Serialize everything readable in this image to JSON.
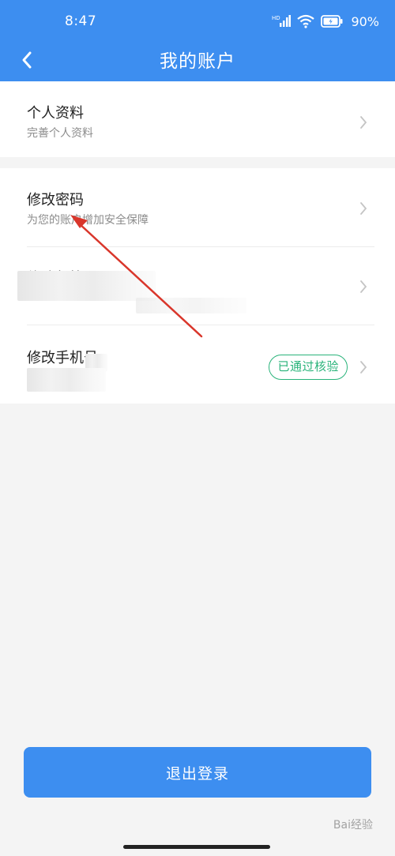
{
  "status_bar": {
    "time": "8:47",
    "network_label": "HD",
    "battery": "90%"
  },
  "header": {
    "title": "我的账户",
    "back_icon": "chevron-left-icon"
  },
  "profile": {
    "title": "个人资料",
    "subtitle": "完善个人资料"
  },
  "security": {
    "items": [
      {
        "title": "修改密码",
        "subtitle": "为您的账户增加安全保障"
      },
      {
        "title": "修改邮箱"
      },
      {
        "title": "修改手机号",
        "badge": "已通过核验"
      }
    ]
  },
  "logout": {
    "label": "退出登录"
  },
  "watermark": {
    "text": "Bai经验"
  },
  "colors": {
    "primary": "#3d8ef0",
    "badge_green": "#29b37a",
    "arrow_red": "#d9362b",
    "background": "#f4f4f4"
  }
}
